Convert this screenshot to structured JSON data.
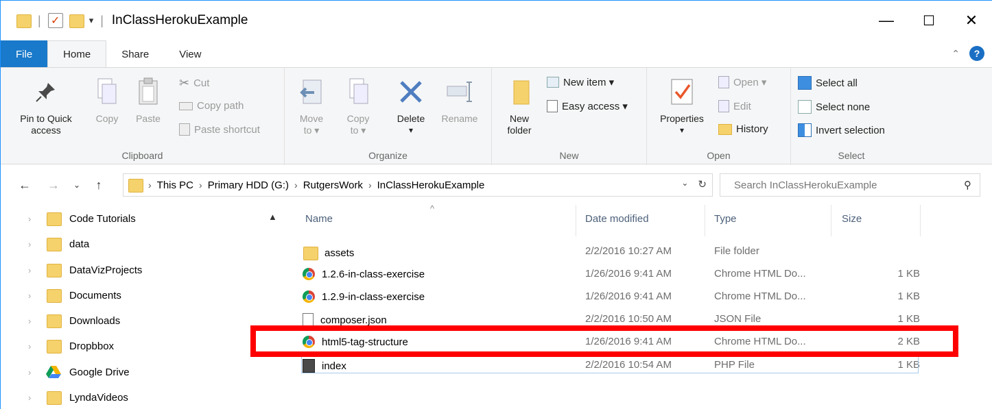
{
  "window": {
    "title": "InClassHerokuExample"
  },
  "titlebar": {
    "controls": {
      "minimize": "—",
      "maximize": "☐",
      "close": "✕"
    }
  },
  "tabs": [
    "File",
    "Home",
    "Share",
    "View"
  ],
  "ribbon": {
    "clipboard": {
      "label": "Clipboard",
      "pin": "Pin to Quick access",
      "pin_line1": "Pin to Quick",
      "pin_line2": "access",
      "copy": "Copy",
      "paste": "Paste",
      "cut": "Cut",
      "copy_path": "Copy path",
      "paste_shortcut": "Paste shortcut"
    },
    "organize": {
      "label": "Organize",
      "move_to_l1": "Move",
      "move_to_l2": "to ▾",
      "copy_to_l1": "Copy",
      "copy_to_l2": "to ▾",
      "delete": "Delete",
      "delete_dd": "▾",
      "rename": "Rename"
    },
    "new": {
      "label": "New",
      "new_folder_l1": "New",
      "new_folder_l2": "folder",
      "new_item": "New item ▾",
      "easy_access": "Easy access ▾"
    },
    "open": {
      "label": "Open",
      "properties": "Properties",
      "properties_dd": "▾",
      "open": "Open ▾",
      "edit": "Edit",
      "history": "History"
    },
    "select": {
      "label": "Select",
      "select_all": "Select all",
      "select_none": "Select none",
      "invert": "Invert selection"
    }
  },
  "address": {
    "crumbs": [
      "This PC",
      "Primary HDD (G:)",
      "RutgersWork",
      "InClassHerokuExample"
    ],
    "search_placeholder": "Search InClassHerokuExample"
  },
  "nav_pane": {
    "items": [
      {
        "label": "Code Tutorials",
        "icon": "folder-icon"
      },
      {
        "label": "data",
        "icon": "folder-icon"
      },
      {
        "label": "DataVizProjects",
        "icon": "folder-icon"
      },
      {
        "label": "Documents",
        "icon": "folder-icon"
      },
      {
        "label": "Downloads",
        "icon": "folder-icon"
      },
      {
        "label": "Dropbbox",
        "icon": "folder-icon"
      },
      {
        "label": "Google Drive",
        "icon": "google-drive-icon"
      },
      {
        "label": "LyndaVideos",
        "icon": "folder-icon"
      }
    ]
  },
  "file_list": {
    "columns": {
      "name": "Name",
      "date": "Date modified",
      "type": "Type",
      "size": "Size"
    },
    "rows": [
      {
        "name": "assets",
        "date": "2/2/2016 10:27 AM",
        "type": "File folder",
        "size": "",
        "icon": "folder-icon"
      },
      {
        "name": "1.2.6-in-class-exercise",
        "date": "1/26/2016 9:41 AM",
        "type": "Chrome HTML Do...",
        "size": "1 KB",
        "icon": "chrome-icon"
      },
      {
        "name": "1.2.9-in-class-exercise",
        "date": "1/26/2016 9:41 AM",
        "type": "Chrome HTML Do...",
        "size": "1 KB",
        "icon": "chrome-icon"
      },
      {
        "name": "composer.json",
        "date": "2/2/2016 10:50 AM",
        "type": "JSON File",
        "size": "1 KB",
        "icon": "file-icon"
      },
      {
        "name": "html5-tag-structure",
        "date": "1/26/2016 9:41 AM",
        "type": "Chrome HTML Do...",
        "size": "2 KB",
        "icon": "chrome-icon"
      },
      {
        "name": "index",
        "date": "2/2/2016 10:54 AM",
        "type": "PHP File",
        "size": "1 KB",
        "icon": "php-icon"
      }
    ]
  },
  "colors": {
    "file_tab": "#1979ca",
    "highlight": "#ff0000",
    "folder": "#f5d26b",
    "column_header": "#4c607a"
  }
}
